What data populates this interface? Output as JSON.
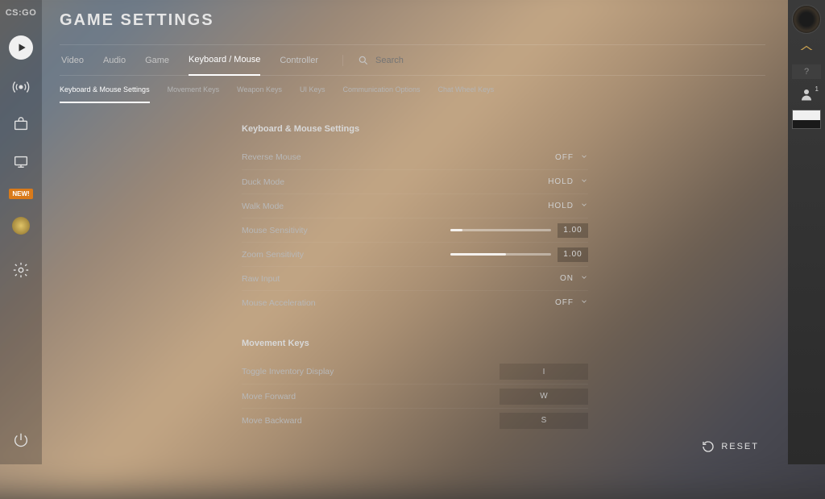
{
  "logo": "CS:GO",
  "title": "GAME SETTINGS",
  "new_badge": "NEW!",
  "tabs": [
    "Video",
    "Audio",
    "Game",
    "Keyboard / Mouse",
    "Controller"
  ],
  "active_tab": 3,
  "search_placeholder": "Search",
  "subtabs": [
    "Keyboard & Mouse Settings",
    "Movement Keys",
    "Weapon Keys",
    "UI Keys",
    "Communication Options",
    "Chat Wheel Keys"
  ],
  "active_subtab": 0,
  "section1": {
    "title": "Keyboard & Mouse Settings",
    "rows": [
      {
        "label": "Reverse Mouse",
        "value": "OFF",
        "type": "dropdown"
      },
      {
        "label": "Duck Mode",
        "value": "HOLD",
        "type": "dropdown"
      },
      {
        "label": "Walk Mode",
        "value": "HOLD",
        "type": "dropdown"
      },
      {
        "label": "Mouse Sensitivity",
        "value": "1.00",
        "type": "slider",
        "fill": 12
      },
      {
        "label": "Zoom Sensitivity",
        "value": "1.00",
        "type": "slider",
        "fill": 55
      },
      {
        "label": "Raw Input",
        "value": "ON",
        "type": "dropdown"
      },
      {
        "label": "Mouse Acceleration",
        "value": "OFF",
        "type": "dropdown"
      }
    ]
  },
  "section2": {
    "title": "Movement Keys",
    "rows": [
      {
        "label": "Toggle Inventory Display",
        "value": "I",
        "type": "keybind"
      },
      {
        "label": "Move Forward",
        "value": "W",
        "type": "keybind"
      },
      {
        "label": "Move Backward",
        "value": "S",
        "type": "keybind"
      }
    ]
  },
  "reset_label": "RESET",
  "right_notify": "1",
  "right_help": "?"
}
